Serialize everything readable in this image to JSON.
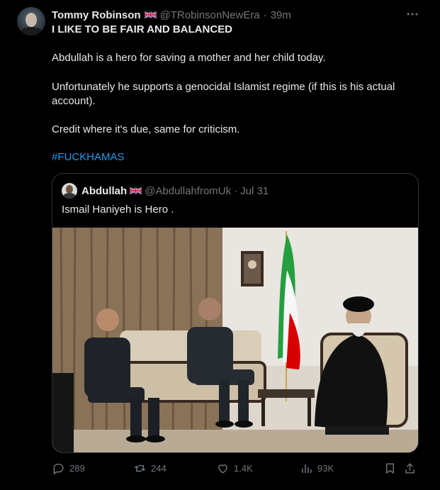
{
  "tweet": {
    "author_name": "Tommy Robinson",
    "author_handle": "@TRobinsonNewEra",
    "separator": "·",
    "time": "39m",
    "lines": [
      "I LIKE TO BE FAIR AND BALANCED",
      "Abdullah is a hero for saving a mother and her child today.",
      "Unfortunately he supports a genocidal Islamist regime (if this is his actual account).",
      "Credit where it's due, same for criticism."
    ],
    "hashtag": "#FUCKHAMAS"
  },
  "quote": {
    "author_name": "Abdullah",
    "author_handle": "@AbdullahfromUk",
    "separator": "·",
    "time": "Jul 31",
    "text": "Ismail Haniyeh is Hero ."
  },
  "actions": {
    "replies": "289",
    "reposts": "244",
    "likes": "1.4K",
    "views": "93K"
  },
  "icons": [
    "more-icon",
    "uk-flag-icon",
    "reply-icon",
    "repost-icon",
    "like-icon",
    "views-icon",
    "bookmark-icon",
    "share-icon"
  ],
  "colors": {
    "background": "#000000",
    "text": "#e7e9ea",
    "muted": "#71767b",
    "link": "#1d9bf0",
    "border": "#2f3336"
  }
}
